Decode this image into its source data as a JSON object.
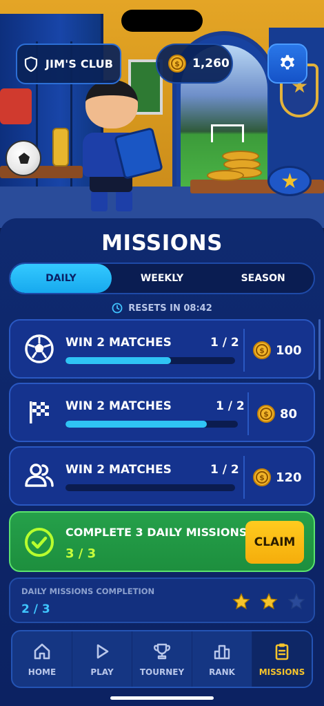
{
  "header": {
    "club_name": "JIM'S CLUB",
    "coin_balance": "1,260"
  },
  "page_title": "MISSIONS",
  "tabs": [
    {
      "label": "DAILY",
      "active": true
    },
    {
      "label": "WEEKLY",
      "active": false
    },
    {
      "label": "SEASON",
      "active": false
    }
  ],
  "resets": {
    "label": "RESETS IN 08:42"
  },
  "missions": [
    {
      "icon": "soccer-ball-icon",
      "title": "WIN 2 MATCHES",
      "progress": "1 / 2",
      "progress_fraction": 0.62,
      "reward": "100"
    },
    {
      "icon": "checkered-flag-icon",
      "title": "WIN 2 MATCHES",
      "progress": "1 / 2",
      "progress_fraction": 0.82,
      "reward": "80"
    },
    {
      "icon": "team-users-icon",
      "title": "WIN 2 MATCHES",
      "progress": "1 / 2",
      "progress_fraction": 0.0,
      "reward": "120"
    }
  ],
  "bonus": {
    "title": "COMPLETE 3 DAILY MISSIONS",
    "progress": "3 / 3",
    "claim_label": "CLAIM"
  },
  "completion": {
    "label": "DAILY MISSIONS COMPLETION",
    "value": "2 / 3",
    "stars_earned": 2,
    "stars_total": 3
  },
  "nav": [
    {
      "label": "HOME",
      "icon": "home-icon",
      "active": false
    },
    {
      "label": "PLAY",
      "icon": "play-icon",
      "active": false
    },
    {
      "label": "TOURNEY",
      "icon": "trophy-icon",
      "active": false
    },
    {
      "label": "RANK",
      "icon": "rank-chart-icon",
      "active": false
    },
    {
      "label": "MISSIONS",
      "icon": "clipboard-icon",
      "active": true
    }
  ],
  "colors": {
    "accent_cyan": "#2fc4f5",
    "claim_yellow": "#ffcb1f",
    "bonus_green": "#25a04a",
    "active_nav": "#f6c42b"
  }
}
